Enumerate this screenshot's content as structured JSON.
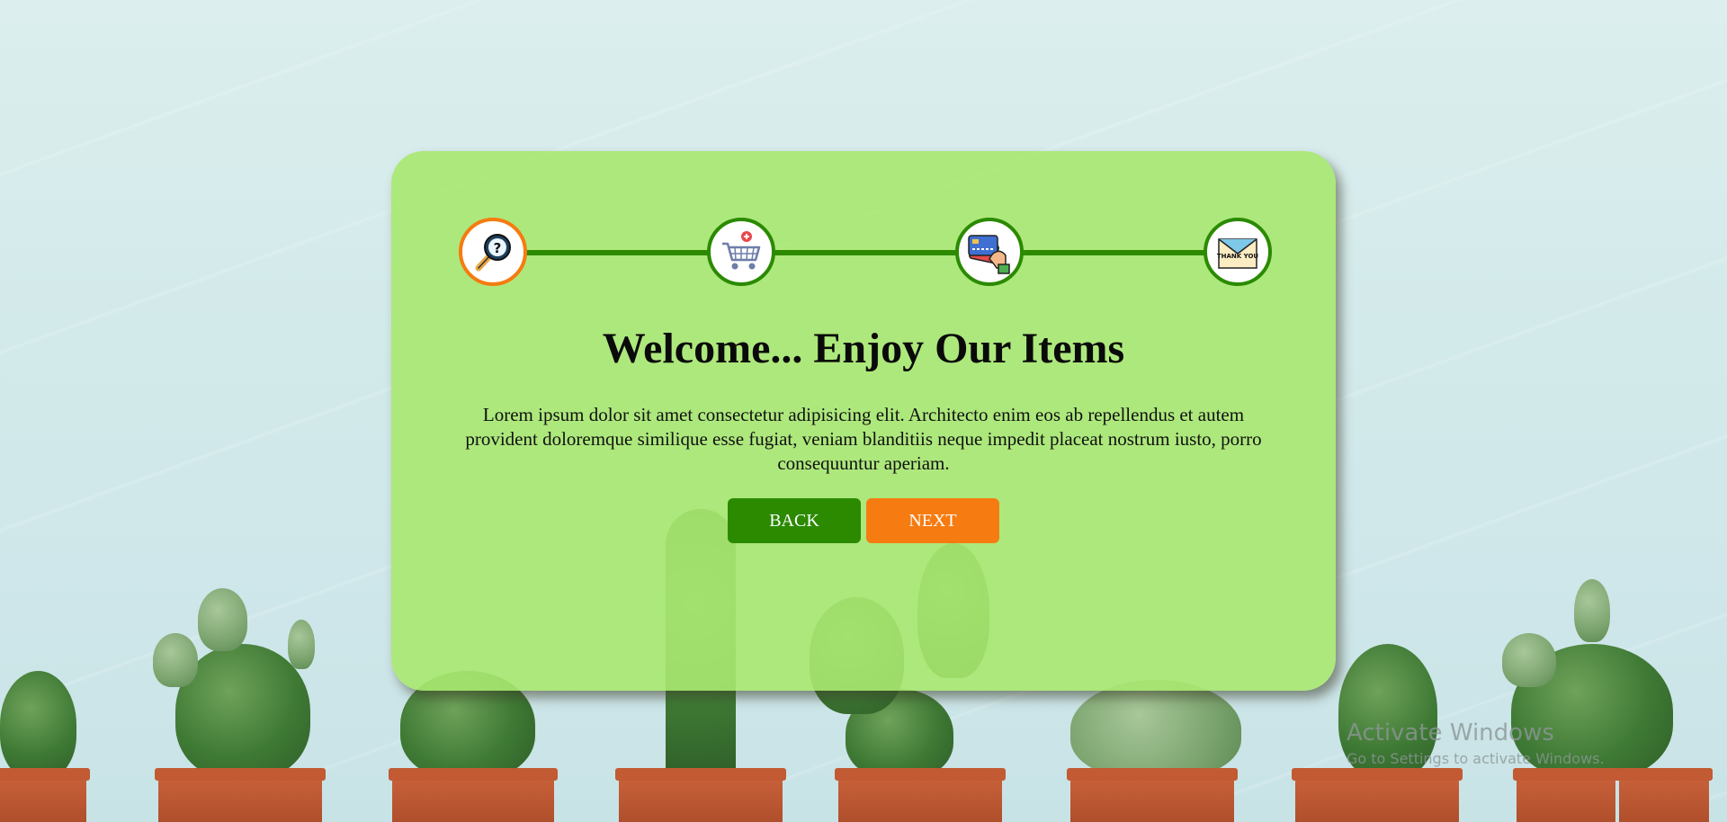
{
  "steps": [
    {
      "icon": "magnifier-question-icon",
      "active": true
    },
    {
      "icon": "shopping-cart-icon",
      "active": false
    },
    {
      "icon": "credit-card-hand-icon",
      "active": false
    },
    {
      "icon": "thank-you-envelope-icon",
      "active": false,
      "text": "THANK YOU"
    }
  ],
  "main": {
    "title": "Welcome... Enjoy Our Items",
    "paragraph": "Lorem ipsum dolor sit amet consectetur adipisicing elit. Architecto enim eos ab repellendus et autem provident doloremque similique esse fugiat, veniam blanditiis neque impedit placeat nostrum iusto, porro consequuntur aperiam."
  },
  "buttons": {
    "back": "BACK",
    "next": "NEXT"
  },
  "colors": {
    "card": "#a8e870",
    "progress": "#2b8a00",
    "active": "#f67b10"
  },
  "watermark": {
    "line1": "Activate Windows",
    "line2": "Go to Settings to activate Windows."
  }
}
